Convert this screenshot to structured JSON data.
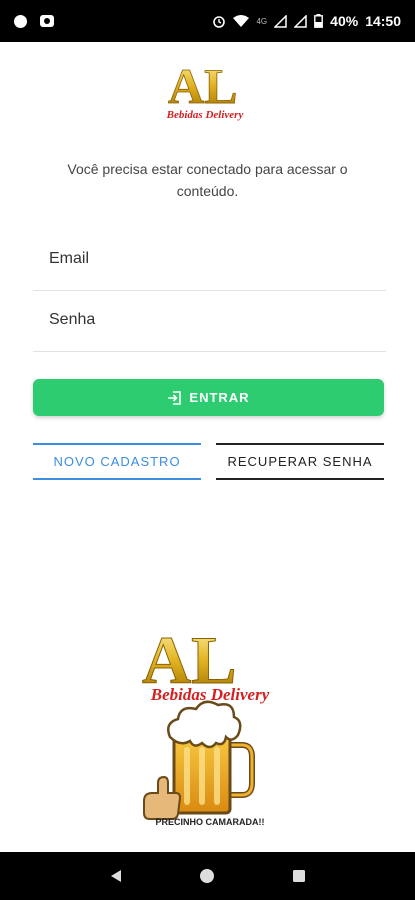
{
  "status_bar": {
    "network_small": "4G",
    "battery": "40%",
    "time": "14:50"
  },
  "brand": {
    "logo_letters": "AL",
    "logo_tagline": "Bebidas Delivery",
    "mascot_caption": "PRECINHO CAMARADA!!"
  },
  "login": {
    "notice": "Você precisa estar conectado para acessar o conteúdo.",
    "email_placeholder": "Email",
    "password_placeholder": "Senha",
    "enter_label": "ENTRAR",
    "register_label": "NOVO CADASTRO",
    "recover_label": "RECUPERAR SENHA"
  },
  "colors": {
    "primary_green": "#2ecc71",
    "link_blue": "#3b8ee0",
    "logo_gold": "#d4a017",
    "logo_red": "#d32020"
  },
  "icons": {
    "enter": "login-icon",
    "nav_back": "back-triangle-icon",
    "nav_home": "home-circle-icon",
    "nav_recent": "recent-square-icon"
  }
}
